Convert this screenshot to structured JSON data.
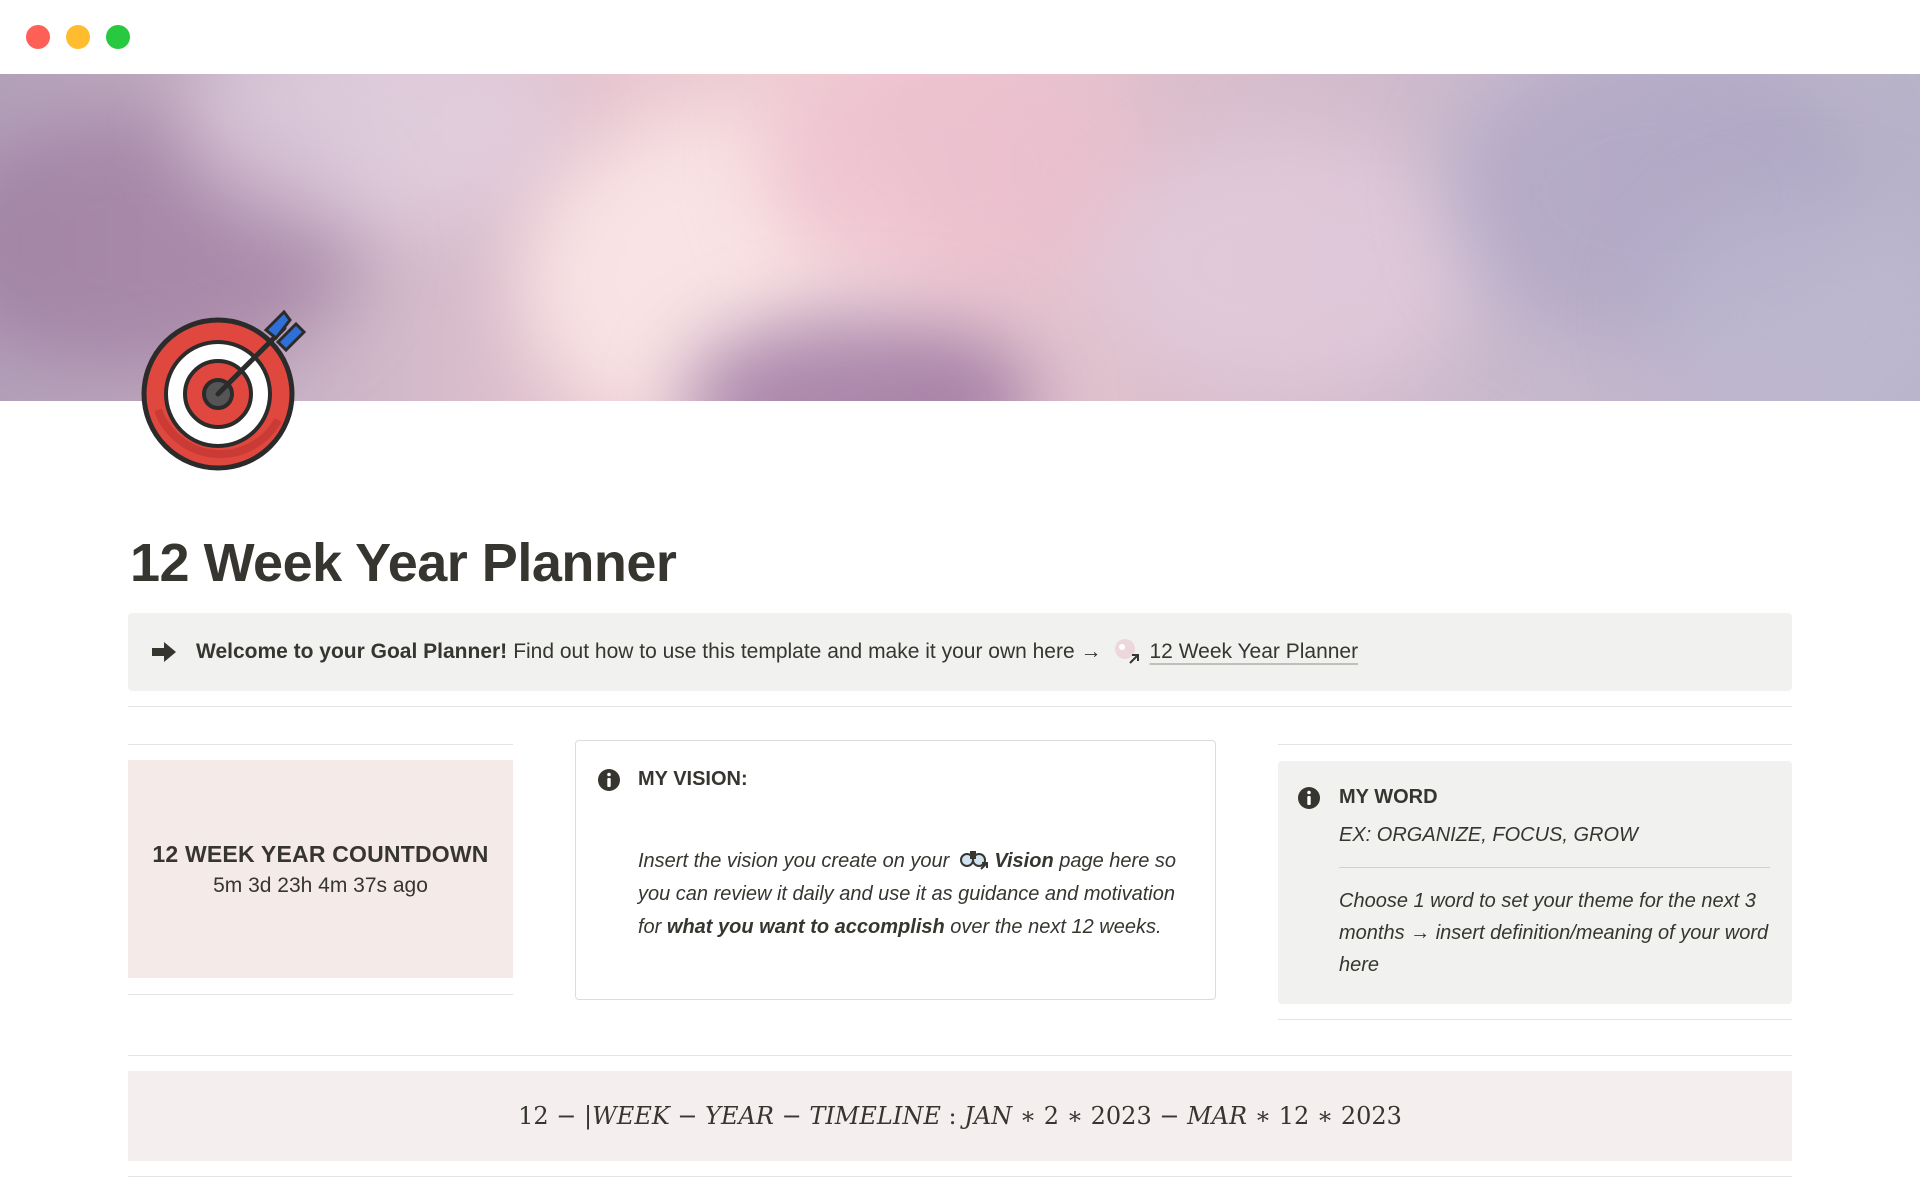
{
  "window": {
    "controls": [
      "close",
      "minimize",
      "maximize"
    ]
  },
  "page": {
    "title": "12 Week Year Planner",
    "icon": "target-icon"
  },
  "welcome_callout": {
    "icon": "arrow-right-icon",
    "bold_text": "Welcome to your Goal Planner!",
    "text": "Find out how to use this template and make it your own here →",
    "link_label": "12 Week Year Planner"
  },
  "countdown": {
    "title": "12 WEEK YEAR COUNTDOWN",
    "value": "5m 3d 23h 4m 37s ago"
  },
  "vision": {
    "icon": "info-icon",
    "title": "MY VISION:",
    "text_1": "Insert the vision you create on your",
    "link_label": "Vision",
    "text_2": "page here so you can review it daily and use it as guidance and motivation for",
    "bold": "what you want to accomplish",
    "text_3": "over the next 12 weeks."
  },
  "my_word": {
    "icon": "info-icon",
    "title": "MY WORD",
    "example": "EX: ORGANIZE, FOCUS, GROW",
    "description": "Choose 1 word to set your theme for the next 3 months → insert definition/meaning of your word here"
  },
  "timeline": {
    "n12": "12",
    "dash1": "−",
    "bar": "|",
    "week": "WEEK",
    "dash2": "−",
    "year": "YEAR",
    "dash3": "−",
    "timeline_word": "TIMELINE",
    "colon": ":",
    "jan": "JAN",
    "star1": "∗",
    "d1": "2",
    "star2": "∗",
    "y1": "2023",
    "dash4": "−",
    "mar": "MAR",
    "star3": "∗",
    "d2": "12",
    "star4": "∗",
    "y2": "2023"
  },
  "colors": {
    "text": "#37352f",
    "callout_gray": "#f1f1ef",
    "countdown_bg": "#f4ebe9",
    "timeline_bg": "#f4efee",
    "target_red": "#e0473e",
    "arrow_blue": "#2f6fd6"
  }
}
